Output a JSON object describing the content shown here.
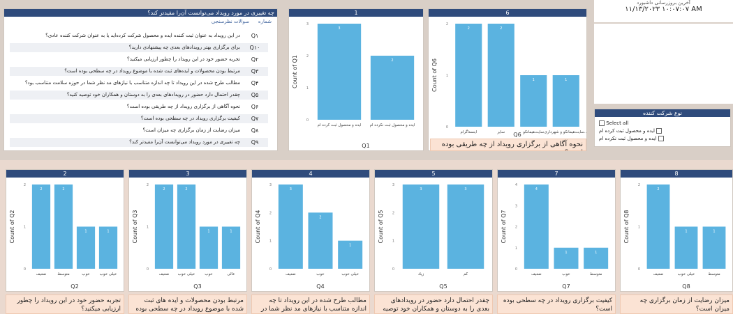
{
  "table": {
    "title": "چه تغییری در مورد رویداد می‌توانست آن‌را مفیدتر کند؟",
    "col_questions": "سوالات نظرسنجی",
    "col_number": "شماره",
    "rows": [
      {
        "code": "Q۱",
        "text": "در این رویداد به عنوان ثبت کننده ایده و محصول شرکت کرده‌اید یا به عنوان شرکت کننده عادی؟"
      },
      {
        "code": "Q۱۰",
        "text": "برای برگزاری بهتر رویدادهای بعدی چه پیشنهادی دارید؟"
      },
      {
        "code": "Q۲",
        "text": "تجربه حضور خود در این رویداد را چطور ارزیابی میکنید؟"
      },
      {
        "code": "Q۳",
        "text": "مرتبط بودن محصولات و ایده‌های ثبت شده با موضوع رویداد در چه سطحی بوده است؟"
      },
      {
        "code": "Q۴",
        "text": "مطالب طرح شده در این رویداد تا چه اندازه متناسب با نیازهای مد نظر شما در حوزه سلامت متناسب بود؟"
      },
      {
        "code": "Q۵",
        "text": "چقدر احتمال دارد حضور در رویدادهای بعدی را به دوستان و همکاران خود توصیه کنید؟"
      },
      {
        "code": "Q۶",
        "text": "نحوه آگاهی از برگزاری رویداد از چه طریقی بوده است؟"
      },
      {
        "code": "Q۷",
        "text": "کیفیت برگزاری رویداد در چه سطحی بوده است؟"
      },
      {
        "code": "Q۸",
        "text": "میزان رضایت از زمان برگزاری چه میزان است؟"
      },
      {
        "code": "Q۹",
        "text": "چه تغییری در مورد رویداد می‌توانست آن‌را مفیدتر کند؟"
      }
    ]
  },
  "topright": {
    "label": "آخرین بروزرسانی داشبورد",
    "value": "۱۱/۱۳/۲۰۲۳ ۱۰:۰۷:۰۷ AM"
  },
  "slicer": {
    "title": "نوع شرکت کننده",
    "items": [
      "Select all",
      "ایده و محصول ثبت کرده ام",
      "ایده و محصول ثبت نکرده ام"
    ]
  },
  "charts": [
    {
      "id": "1",
      "xlabel": "Q1",
      "ylabel": "Count of Q1",
      "caption": "",
      "chart_data": {
        "type": "bar",
        "categories": [
          "ایده و محصول ثبت کرده ام",
          "ایده و محصول ثبت نکرده ام"
        ],
        "values": [
          3,
          2
        ],
        "ylim": [
          0,
          3
        ]
      }
    },
    {
      "id": "6",
      "xlabel": "Q6",
      "ylabel": "Count of Q6",
      "caption": "نحوه آگاهی از برگزاری رویداد از چه طریقی بوده است؟",
      "chart_data": {
        "type": "bar",
        "categories": [
          "اینستاگرام",
          "سایر",
          "سایت‌هیمانکو",
          "...سایت‌هیمانکو و شهرداری"
        ],
        "values": [
          2,
          2,
          1,
          1
        ],
        "ylim": [
          0,
          2
        ]
      }
    },
    {
      "id": "2",
      "xlabel": "Q2",
      "ylabel": "Count of Q2",
      "caption": "تجربه حضور خود در این رویداد را چطور ارزیابی میکنید؟",
      "chart_data": {
        "type": "bar",
        "categories": [
          "ضعیف",
          "متوسط",
          "خوب",
          "خیلی خوب"
        ],
        "values": [
          2,
          2,
          1,
          1
        ],
        "ylim": [
          0,
          2
        ]
      }
    },
    {
      "id": "3",
      "xlabel": "Q3",
      "ylabel": "Count of Q3",
      "caption": "مرتبط بودن محصولات و ایده های ثبت شده با موضوع رویداد در چه سطحی بوده",
      "chart_data": {
        "type": "bar",
        "categories": [
          "ضعیف",
          "خیلی خوب",
          "خوب",
          "عالی"
        ],
        "values": [
          2,
          2,
          1,
          1
        ],
        "ylim": [
          0,
          2
        ]
      }
    },
    {
      "id": "4",
      "xlabel": "Q4",
      "ylabel": "Count of Q4",
      "caption": "مطالب طرح شده در این رویداد تا چه اندازه متناسب با نیازهای مد نظر شما در حوزه",
      "chart_data": {
        "type": "bar",
        "categories": [
          "ضعیف",
          "خوب",
          "خیلی خوب"
        ],
        "values": [
          3,
          2,
          1
        ],
        "ylim": [
          0,
          3
        ]
      }
    },
    {
      "id": "5",
      "xlabel": "Q5",
      "ylabel": "Count of Q5",
      "caption": "چقدر احتمال دارد حضور در رویدادهای بعدی را به دوستان و همکاران خود توصیه",
      "chart_data": {
        "type": "bar",
        "categories": [
          "زیاد",
          "کم"
        ],
        "values": [
          3,
          3
        ],
        "ylim": [
          0,
          3
        ]
      }
    },
    {
      "id": "7",
      "xlabel": "Q7",
      "ylabel": "Count of Q7",
      "caption": "کیفیت برگزاری رویداد در چه سطحی بوده است؟",
      "chart_data": {
        "type": "bar",
        "categories": [
          "ضعیف",
          "خوب",
          "متوسط"
        ],
        "values": [
          4,
          1,
          1
        ],
        "ylim": [
          0,
          4
        ]
      }
    },
    {
      "id": "8",
      "xlabel": "Q8",
      "ylabel": "Count of Q8",
      "caption": "میزان رضایت از زمان برگزاری چه میزان است؟",
      "chart_data": {
        "type": "bar",
        "categories": [
          "ضعیف",
          "خیلی خوب",
          "متوسط"
        ],
        "values": [
          2,
          1,
          1
        ],
        "ylim": [
          0,
          2
        ]
      }
    }
  ],
  "colors": {
    "bar": "#5bb3e0",
    "header": "#2f4b7c",
    "caption_bg": "#fbe3d4"
  }
}
